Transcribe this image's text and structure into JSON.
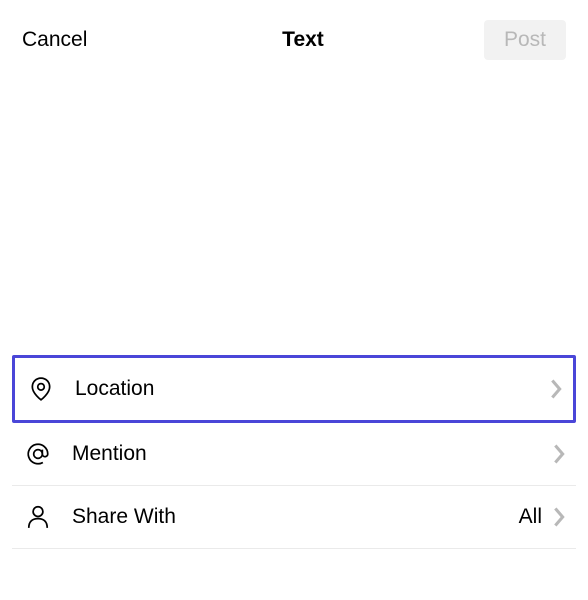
{
  "header": {
    "cancel_label": "Cancel",
    "title": "Text",
    "post_label": "Post"
  },
  "options": {
    "location": {
      "label": "Location"
    },
    "mention": {
      "label": "Mention"
    },
    "share_with": {
      "label": "Share With",
      "value": "All"
    }
  }
}
